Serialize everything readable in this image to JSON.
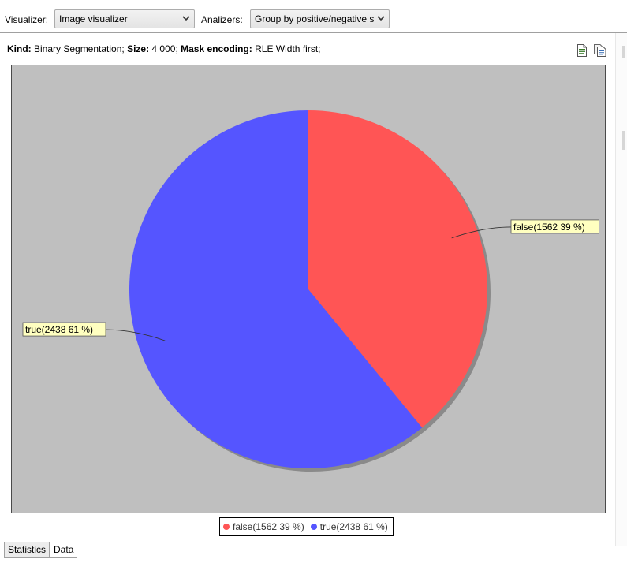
{
  "toolbar": {
    "visualizer_label": "Visualizer:",
    "visualizer_value": "Image visualizer",
    "analyzers_label": "Analizers:",
    "analyzers_value": "Group by positive/negative s"
  },
  "info": {
    "kind_label": "Kind:",
    "kind_value": " Binary Segmentation; ",
    "size_label": "Size:",
    "size_value": " 4 000; ",
    "mask_label": "Mask encoding:",
    "mask_value": " RLE Width first;"
  },
  "icons": {
    "export": "export-document-icon",
    "copy": "copy-document-icon",
    "dropdown": "chevron-down-icon"
  },
  "colors": {
    "false": "#ff5555",
    "true": "#5555ff",
    "plot_bg": "#bfbfbf",
    "label_bg": "#ffffc0"
  },
  "chart_data": {
    "type": "pie",
    "slices": [
      {
        "name": "false",
        "value": 1562,
        "percent": 39,
        "label": "false(1562 39 %)",
        "color": "#ff5555"
      },
      {
        "name": "true",
        "value": 2438,
        "percent": 61,
        "label": "true(2438 61 %)",
        "color": "#5555ff"
      }
    ],
    "start": "12 o'clock",
    "direction": "clockwise",
    "legend": [
      "false(1562 39 %)",
      "true(2438 61 %)"
    ],
    "legend_position": "bottom"
  },
  "tabs": [
    {
      "label": "Statistics",
      "active": false
    },
    {
      "label": "Data",
      "active": true
    }
  ]
}
